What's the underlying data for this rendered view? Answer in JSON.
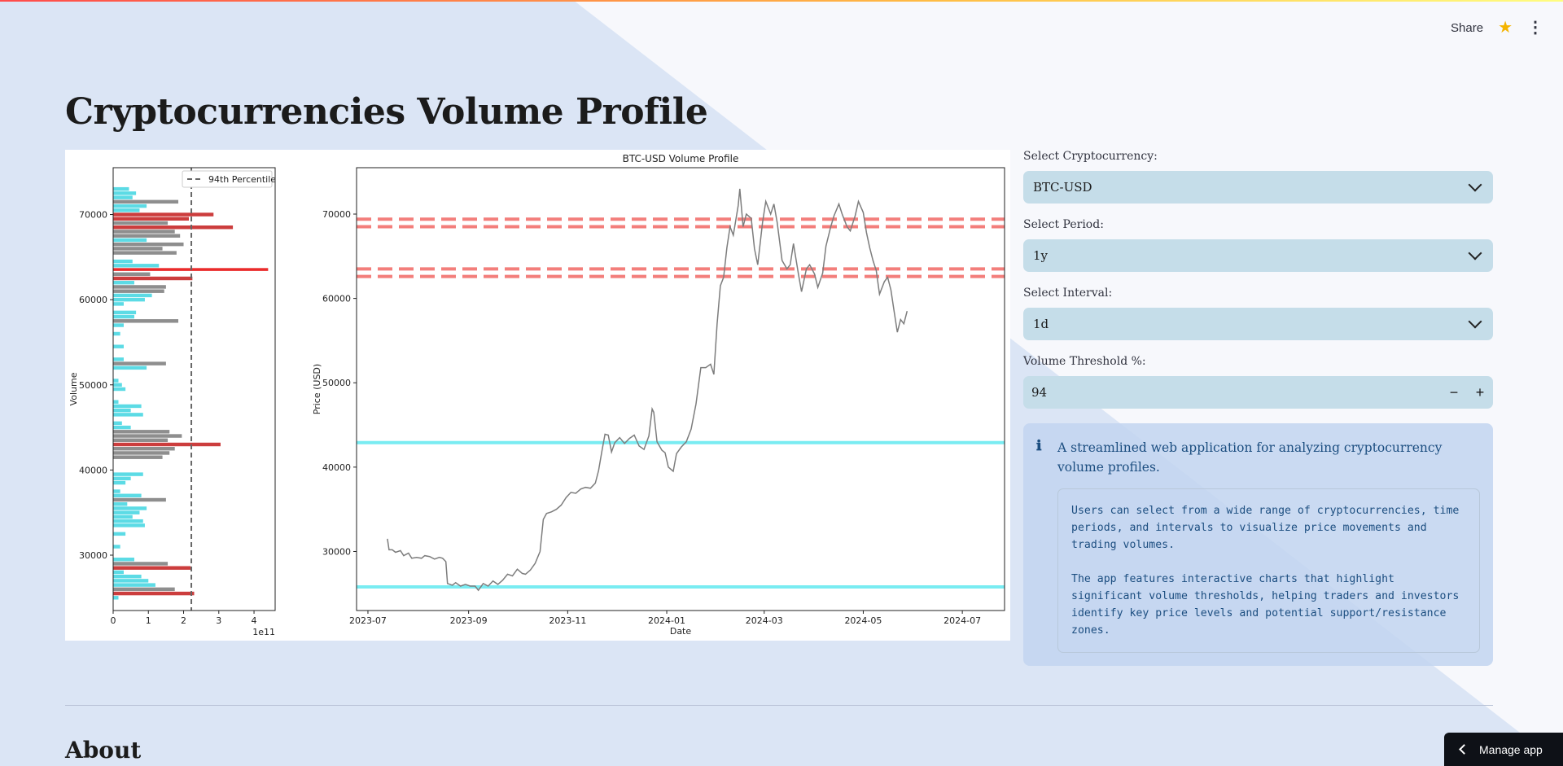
{
  "header": {
    "share_label": "Share"
  },
  "page": {
    "title": "Cryptocurrencies Volume Profile",
    "about_heading": "About"
  },
  "controls": {
    "crypto_label": "Select Cryptocurrency:",
    "crypto_value": "BTC-USD",
    "period_label": "Select Period:",
    "period_value": "1y",
    "interval_label": "Select Interval:",
    "interval_value": "1d",
    "threshold_label": "Volume Threshold %:",
    "threshold_value": "94",
    "minus": "−",
    "plus": "+"
  },
  "info": {
    "icon": "ℹ",
    "summary": "A streamlined web application for analyzing cryptocurrency volume profiles.",
    "details": "Users can select from a wide range of cryptocurrencies, time periods, and intervals to visualize price movements and trading volumes.\n\nThe app features interactive charts that highlight significant volume thresholds, helping traders and investors identify key price levels and potential support/resistance zones."
  },
  "manage_app": "Manage app",
  "colors": {
    "accent_red": "#e53935",
    "cyan": "#4dd8e6",
    "grey_bar": "#7f7f7f"
  },
  "chart_data": [
    {
      "type": "bar",
      "orientation": "horizontal",
      "ylabel": "Volume",
      "x_offset_label": "1e11",
      "xticks": [
        0,
        1,
        2,
        3,
        4
      ],
      "yticks": [
        30000,
        40000,
        50000,
        60000,
        70000
      ],
      "ylim": [
        23500,
        75500
      ],
      "xlim": [
        0,
        4.6
      ],
      "legend": [
        "94th Percentile"
      ],
      "legend_position": "top-right",
      "threshold": 2.22,
      "bins": [
        {
          "price": 25000,
          "vol": 0.15,
          "c": "cyan"
        },
        {
          "price": 25500,
          "vol": 2.3,
          "c": "red"
        },
        {
          "price": 26000,
          "vol": 1.75,
          "c": "grey"
        },
        {
          "price": 26500,
          "vol": 1.2,
          "c": "cyan"
        },
        {
          "price": 27000,
          "vol": 1.0,
          "c": "cyan"
        },
        {
          "price": 27500,
          "vol": 0.8,
          "c": "cyan"
        },
        {
          "price": 28000,
          "vol": 0.3,
          "c": "cyan"
        },
        {
          "price": 28500,
          "vol": 2.2,
          "c": "red"
        },
        {
          "price": 29000,
          "vol": 1.55,
          "c": "grey"
        },
        {
          "price": 29500,
          "vol": 0.6,
          "c": "cyan"
        },
        {
          "price": 31000,
          "vol": 0.2,
          "c": "cyan"
        },
        {
          "price": 32500,
          "vol": 0.35,
          "c": "cyan"
        },
        {
          "price": 33500,
          "vol": 0.9,
          "c": "cyan"
        },
        {
          "price": 34000,
          "vol": 0.85,
          "c": "cyan"
        },
        {
          "price": 34500,
          "vol": 0.55,
          "c": "cyan"
        },
        {
          "price": 35000,
          "vol": 0.75,
          "c": "cyan"
        },
        {
          "price": 35500,
          "vol": 0.95,
          "c": "cyan"
        },
        {
          "price": 36000,
          "vol": 0.4,
          "c": "cyan"
        },
        {
          "price": 36500,
          "vol": 1.5,
          "c": "grey"
        },
        {
          "price": 37000,
          "vol": 0.8,
          "c": "cyan"
        },
        {
          "price": 37500,
          "vol": 0.2,
          "c": "cyan"
        },
        {
          "price": 38500,
          "vol": 0.35,
          "c": "cyan"
        },
        {
          "price": 39000,
          "vol": 0.5,
          "c": "cyan"
        },
        {
          "price": 39500,
          "vol": 0.85,
          "c": "cyan"
        },
        {
          "price": 41500,
          "vol": 1.4,
          "c": "grey"
        },
        {
          "price": 42000,
          "vol": 1.6,
          "c": "grey"
        },
        {
          "price": 42500,
          "vol": 1.75,
          "c": "grey"
        },
        {
          "price": 43000,
          "vol": 3.05,
          "c": "red"
        },
        {
          "price": 43500,
          "vol": 1.55,
          "c": "grey"
        },
        {
          "price": 44000,
          "vol": 1.95,
          "c": "grey"
        },
        {
          "price": 44500,
          "vol": 1.6,
          "c": "grey"
        },
        {
          "price": 45000,
          "vol": 0.5,
          "c": "cyan"
        },
        {
          "price": 45500,
          "vol": 0.25,
          "c": "cyan"
        },
        {
          "price": 46500,
          "vol": 0.85,
          "c": "cyan"
        },
        {
          "price": 47000,
          "vol": 0.5,
          "c": "cyan"
        },
        {
          "price": 47500,
          "vol": 0.8,
          "c": "cyan"
        },
        {
          "price": 48000,
          "vol": 0.15,
          "c": "cyan"
        },
        {
          "price": 49500,
          "vol": 0.35,
          "c": "cyan"
        },
        {
          "price": 50000,
          "vol": 0.25,
          "c": "cyan"
        },
        {
          "price": 50500,
          "vol": 0.15,
          "c": "cyan"
        },
        {
          "price": 52000,
          "vol": 0.95,
          "c": "cyan"
        },
        {
          "price": 52500,
          "vol": 1.5,
          "c": "grey"
        },
        {
          "price": 53000,
          "vol": 0.3,
          "c": "cyan"
        },
        {
          "price": 54500,
          "vol": 0.3,
          "c": "cyan"
        },
        {
          "price": 56000,
          "vol": 0.2,
          "c": "cyan"
        },
        {
          "price": 57000,
          "vol": 0.3,
          "c": "cyan"
        },
        {
          "price": 57500,
          "vol": 1.85,
          "c": "grey"
        },
        {
          "price": 58000,
          "vol": 0.6,
          "c": "cyan"
        },
        {
          "price": 58500,
          "vol": 0.65,
          "c": "cyan"
        },
        {
          "price": 59500,
          "vol": 0.3,
          "c": "cyan"
        },
        {
          "price": 60000,
          "vol": 0.9,
          "c": "cyan"
        },
        {
          "price": 60500,
          "vol": 1.1,
          "c": "cyan"
        },
        {
          "price": 61000,
          "vol": 1.45,
          "c": "grey"
        },
        {
          "price": 61500,
          "vol": 1.5,
          "c": "grey"
        },
        {
          "price": 62000,
          "vol": 0.6,
          "c": "cyan"
        },
        {
          "price": 62500,
          "vol": 2.25,
          "c": "red"
        },
        {
          "price": 63000,
          "vol": 1.05,
          "c": "grey"
        },
        {
          "price": 63500,
          "vol": 4.4,
          "c": "red"
        },
        {
          "price": 64000,
          "vol": 1.3,
          "c": "cyan"
        },
        {
          "price": 64500,
          "vol": 0.55,
          "c": "cyan"
        },
        {
          "price": 65500,
          "vol": 1.8,
          "c": "grey"
        },
        {
          "price": 66000,
          "vol": 1.4,
          "c": "grey"
        },
        {
          "price": 66500,
          "vol": 2.0,
          "c": "grey"
        },
        {
          "price": 67000,
          "vol": 0.95,
          "c": "cyan"
        },
        {
          "price": 67500,
          "vol": 1.9,
          "c": "grey"
        },
        {
          "price": 68000,
          "vol": 1.75,
          "c": "grey"
        },
        {
          "price": 68500,
          "vol": 3.4,
          "c": "red"
        },
        {
          "price": 69000,
          "vol": 1.55,
          "c": "grey"
        },
        {
          "price": 69500,
          "vol": 2.15,
          "c": "red"
        },
        {
          "price": 70000,
          "vol": 2.85,
          "c": "red"
        },
        {
          "price": 70500,
          "vol": 0.75,
          "c": "cyan"
        },
        {
          "price": 71000,
          "vol": 0.95,
          "c": "cyan"
        },
        {
          "price": 71500,
          "vol": 1.85,
          "c": "grey"
        },
        {
          "price": 72000,
          "vol": 0.55,
          "c": "cyan"
        },
        {
          "price": 72500,
          "vol": 0.65,
          "c": "cyan"
        },
        {
          "price": 73000,
          "vol": 0.45,
          "c": "cyan"
        }
      ]
    },
    {
      "type": "line",
      "title": "BTC-USD Volume Profile",
      "xlabel": "Date",
      "ylabel": "Price (USD)",
      "xticks": [
        "2023-07",
        "2023-09",
        "2023-11",
        "2024-01",
        "2024-03",
        "2024-05",
        "2024-07"
      ],
      "xtick_days": [
        0,
        62,
        123,
        184,
        244,
        305,
        366
      ],
      "xlim_days": [
        -7,
        392
      ],
      "yticks": [
        30000,
        40000,
        50000,
        60000,
        70000
      ],
      "ylim": [
        23000,
        75500
      ],
      "red_lines": [
        69400,
        68500,
        63500,
        62600
      ],
      "cyan_lines": [
        42900,
        25800
      ],
      "series": [
        {
          "name": "",
          "points": [
            [
              12,
              31500
            ],
            [
              13,
              30200
            ],
            [
              15,
              30200
            ],
            [
              17,
              29900
            ],
            [
              20,
              30100
            ],
            [
              22,
              29500
            ],
            [
              25,
              29800
            ],
            [
              27,
              29200
            ],
            [
              30,
              29300
            ],
            [
              33,
              29200
            ],
            [
              35,
              29500
            ],
            [
              38,
              29400
            ],
            [
              41,
              29100
            ],
            [
              44,
              29300
            ],
            [
              46,
              29200
            ],
            [
              48,
              28800
            ],
            [
              49,
              26200
            ],
            [
              52,
              26000
            ],
            [
              54,
              26300
            ],
            [
              57,
              25900
            ],
            [
              60,
              26100
            ],
            [
              63,
              25900
            ],
            [
              66,
              25900
            ],
            [
              68,
              25400
            ],
            [
              71,
              26200
            ],
            [
              74,
              25900
            ],
            [
              77,
              26500
            ],
            [
              80,
              26100
            ],
            [
              83,
              26600
            ],
            [
              86,
              27300
            ],
            [
              89,
              27100
            ],
            [
              92,
              27900
            ],
            [
              95,
              27400
            ],
            [
              97,
              27300
            ],
            [
              100,
              27800
            ],
            [
              103,
              28600
            ],
            [
              106,
              30000
            ],
            [
              108,
              33800
            ],
            [
              110,
              34500
            ],
            [
              113,
              34700
            ],
            [
              116,
              35000
            ],
            [
              119,
              35500
            ],
            [
              122,
              36400
            ],
            [
              125,
              37000
            ],
            [
              128,
              36900
            ],
            [
              131,
              37400
            ],
            [
              134,
              37600
            ],
            [
              137,
              37500
            ],
            [
              140,
              38100
            ],
            [
              142,
              39600
            ],
            [
              144,
              41800
            ],
            [
              146,
              43900
            ],
            [
              148,
              43800
            ],
            [
              150,
              41800
            ],
            [
              152,
              42900
            ],
            [
              155,
              43500
            ],
            [
              158,
              42800
            ],
            [
              161,
              43400
            ],
            [
              164,
              43800
            ],
            [
              167,
              42500
            ],
            [
              170,
              42100
            ],
            [
              173,
              43700
            ],
            [
              175,
              46900
            ],
            [
              176,
              46500
            ],
            [
              178,
              43000
            ],
            [
              181,
              42000
            ],
            [
              183,
              41700
            ],
            [
              185,
              40000
            ],
            [
              188,
              39500
            ],
            [
              190,
              41600
            ],
            [
              193,
              42400
            ],
            [
              196,
              43000
            ],
            [
              199,
              44500
            ],
            [
              202,
              47500
            ],
            [
              205,
              51800
            ],
            [
              208,
              51800
            ],
            [
              211,
              52200
            ],
            [
              213,
              51000
            ],
            [
              215,
              57000
            ],
            [
              217,
              61500
            ],
            [
              219,
              62500
            ],
            [
              221,
              66000
            ],
            [
              223,
              68500
            ],
            [
              225,
              67500
            ],
            [
              228,
              71000
            ],
            [
              229,
              73000
            ],
            [
              231,
              68500
            ],
            [
              233,
              70000
            ],
            [
              236,
              69500
            ],
            [
              238,
              65900
            ],
            [
              240,
              64000
            ],
            [
              243,
              69000
            ],
            [
              245,
              71500
            ],
            [
              248,
              70000
            ],
            [
              250,
              71200
            ],
            [
              252,
              69000
            ],
            [
              255,
              64500
            ],
            [
              258,
              63500
            ],
            [
              260,
              64000
            ],
            [
              262,
              66500
            ],
            [
              265,
              63000
            ],
            [
              267,
              60800
            ],
            [
              270,
              63500
            ],
            [
              272,
              64000
            ],
            [
              275,
              62900
            ],
            [
              277,
              61300
            ],
            [
              280,
              63000
            ],
            [
              282,
              66200
            ],
            [
              285,
              68500
            ],
            [
              287,
              69800
            ],
            [
              290,
              71200
            ],
            [
              292,
              70000
            ],
            [
              295,
              68500
            ],
            [
              297,
              68000
            ],
            [
              300,
              69800
            ],
            [
              302,
              71500
            ],
            [
              305,
              70200
            ],
            [
              307,
              67800
            ],
            [
              309,
              66000
            ],
            [
              311,
              64500
            ],
            [
              313,
              63300
            ],
            [
              315,
              60500
            ],
            [
              318,
              62000
            ],
            [
              320,
              62500
            ],
            [
              322,
              61000
            ],
            [
              324,
              58500
            ],
            [
              326,
              56000
            ],
            [
              328,
              57500
            ],
            [
              330,
              57000
            ],
            [
              332,
              58500
            ]
          ]
        }
      ]
    }
  ]
}
